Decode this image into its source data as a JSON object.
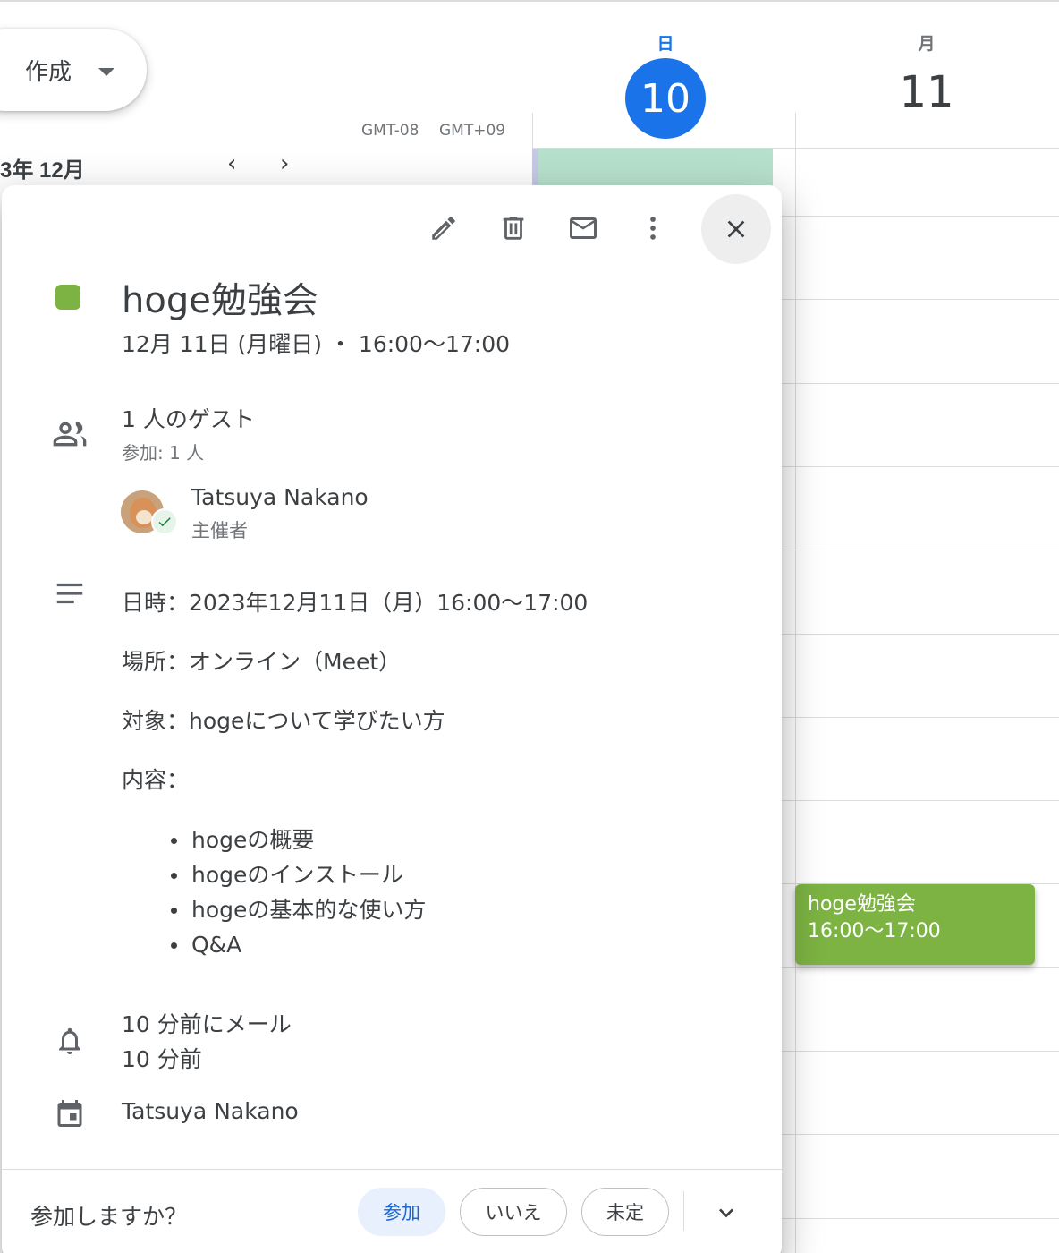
{
  "app": {
    "create_label": "作成",
    "timezones": [
      "GMT-08",
      "GMT+09"
    ],
    "mini_calendar_month": "3年 12月",
    "nav_prev": "‹",
    "nav_next": "›"
  },
  "days": [
    {
      "dow": "日",
      "num": "10",
      "today": true
    },
    {
      "dow": "月",
      "num": "11",
      "today": false
    }
  ],
  "colors": {
    "accent": "#1a73e8",
    "event": "#7cb342",
    "allday": "#b7e1cd"
  },
  "event_chip": {
    "title": "hoge勉強会",
    "time": "16:00〜17:00"
  },
  "popup": {
    "toolbar": [
      "edit-icon",
      "delete-icon",
      "email-icon",
      "more-icon",
      "close-icon"
    ],
    "title": "hoge勉強会",
    "datetime": "12月 11日 (月曜日) ・ 16:00〜17:00",
    "guests": {
      "summary": "1 人のゲスト",
      "status": "参加: 1 人",
      "list": [
        {
          "name": "Tatsuya Nakano",
          "role": "主催者"
        }
      ]
    },
    "description": {
      "lines": [
        "日時：2023年12月11日（月）16:00〜17:00",
        "場所：オンライン（Meet）",
        "対象：hogeについて学びたい方",
        "内容："
      ],
      "bullets": [
        "hogeの概要",
        "hogeのインストール",
        "hogeの基本的な使い方",
        "Q&A"
      ]
    },
    "notifications": [
      "10 分前にメール",
      "10 分前"
    ],
    "calendar_owner": "Tatsuya Nakano",
    "rsvp": {
      "question": "参加しますか？",
      "yes": "参加",
      "no": "いいえ",
      "maybe": "未定"
    }
  }
}
